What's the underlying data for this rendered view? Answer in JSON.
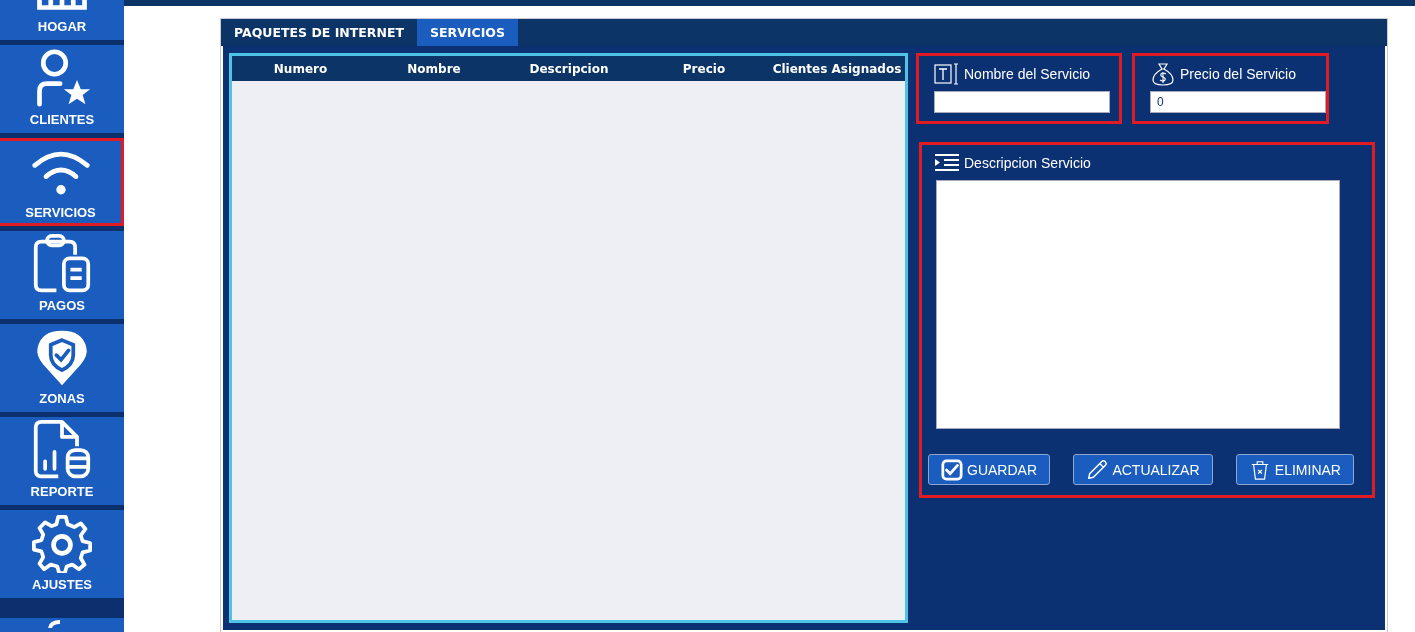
{
  "sidebar": {
    "items": [
      {
        "label": "HOGAR",
        "selected": false
      },
      {
        "label": "CLIENTES",
        "selected": false
      },
      {
        "label": "SERVICIOS",
        "selected": true
      },
      {
        "label": "PAGOS",
        "selected": false
      },
      {
        "label": "ZONAS",
        "selected": false
      },
      {
        "label": "REPORTE",
        "selected": false
      },
      {
        "label": "AJUSTES",
        "selected": false
      }
    ]
  },
  "tabs": [
    {
      "label": "PAQUETES DE INTERNET",
      "selected": false
    },
    {
      "label": "SERVICIOS",
      "selected": true
    }
  ],
  "table": {
    "columns": [
      "Numero",
      "Nombre",
      "Descripcion",
      "Precio",
      "Clientes Asignados"
    ]
  },
  "form": {
    "name_field": {
      "label": "Nombre del Servicio"
    },
    "price_field": {
      "label": "Precio del Servicio",
      "value": "0"
    },
    "description_field": {
      "label": "Descripcion Servicio"
    },
    "buttons": [
      {
        "label": "GUARDAR"
      },
      {
        "label": "ACTUALIZAR"
      },
      {
        "label": "ELIMINAR"
      }
    ]
  }
}
